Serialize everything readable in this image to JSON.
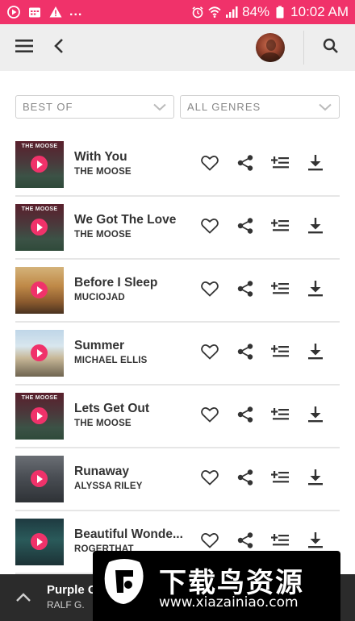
{
  "status_bar": {
    "left_icons": [
      "play-store-icon",
      "calendar-icon",
      "warning-icon"
    ],
    "more": "...",
    "right_icons": [
      "alarm-icon",
      "wifi-icon",
      "signal-icon"
    ],
    "battery": "84%",
    "time": "10:02 AM",
    "color": "#f0326a"
  },
  "app_bar": {
    "menu_icon": "hamburger-menu-icon",
    "back_icon": "back-chevron-icon",
    "search_icon": "search-icon"
  },
  "filters": {
    "left": "BEST OF",
    "right": "ALL GENRES"
  },
  "tracks": [
    {
      "title": "With You",
      "artist": "THE MOOSE",
      "art_caption": "THE MOOSE"
    },
    {
      "title": "We Got The Love",
      "artist": "THE MOOSE",
      "art_caption": "THE MOOSE"
    },
    {
      "title": "Before I Sleep",
      "artist": "MUCIOJAD",
      "art_caption": ""
    },
    {
      "title": "Summer",
      "artist": "MICHAEL ELLIS",
      "art_caption": ""
    },
    {
      "title": "Lets Get Out",
      "artist": "THE MOOSE",
      "art_caption": "THE MOOSE"
    },
    {
      "title": "Runaway",
      "artist": "ALYSSA RILEY",
      "art_caption": ""
    },
    {
      "title": "Beautiful Wonde...",
      "artist": "ROGERTHAT",
      "art_caption": ""
    }
  ],
  "row_actions": [
    "heart-icon",
    "share-icon",
    "add-to-queue-icon",
    "download-icon"
  ],
  "mini_player": {
    "title": "Purple C",
    "artist": "RALF G."
  },
  "watermark": {
    "cn_text": "下载鸟资源",
    "url": "www.xiazainiao.com"
  },
  "accent_color": "#f0326a"
}
